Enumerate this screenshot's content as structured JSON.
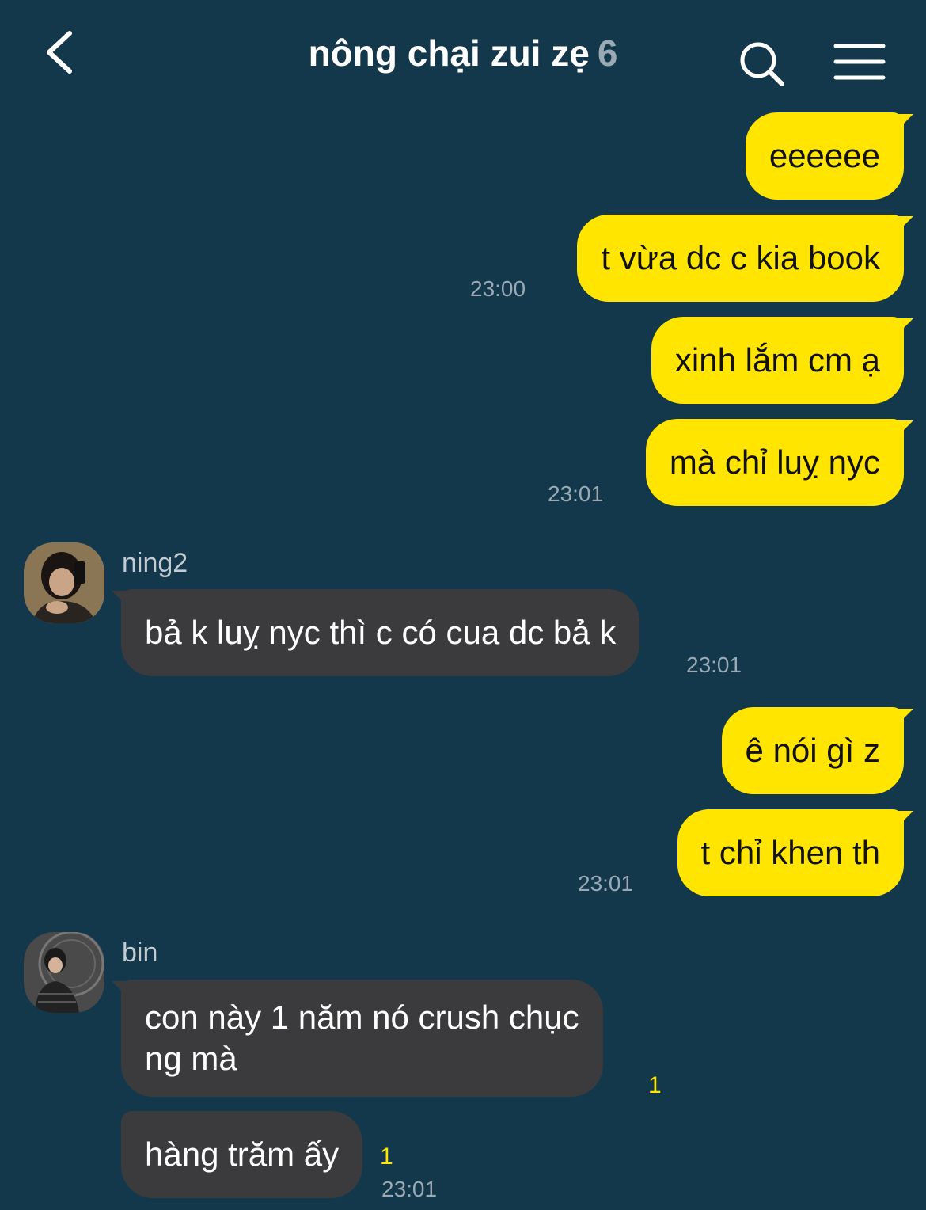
{
  "header": {
    "title": "nông chại zui zẹ",
    "member_count": "6",
    "back_icon": "chevron-left-icon",
    "search_icon": "search-icon",
    "menu_icon": "hamburger-menu-icon"
  },
  "colors": {
    "background": "#13374b",
    "my_bubble": "#ffe500",
    "their_bubble": "#3b3b3d",
    "timestamp": "#9aa9b3",
    "unread": "#ffe500"
  },
  "messages": [
    {
      "from": "me",
      "text": "eeeeee"
    },
    {
      "from": "me",
      "text": "t vừa dc c kia book",
      "time": "23:00"
    },
    {
      "from": "me",
      "text": "xinh lắm cm ạ"
    },
    {
      "from": "me",
      "text": "mà chỉ luỵ nyc",
      "time": "23:01"
    },
    {
      "from": "ning2",
      "sender": "ning2",
      "text": "bả k luỵ nyc thì c có cua dc bả k",
      "time": "23:01"
    },
    {
      "from": "me",
      "text": "ê nói gì z"
    },
    {
      "from": "me",
      "text": "t chỉ khen th",
      "time": "23:01"
    },
    {
      "from": "bin",
      "sender": "bin",
      "text_line1": "con này 1 năm nó crush chục",
      "text_line2": "ng mà",
      "unread": "1"
    },
    {
      "from": "bin",
      "text": "hàng trăm ấy",
      "unread": "1",
      "time": "23:01"
    }
  ]
}
